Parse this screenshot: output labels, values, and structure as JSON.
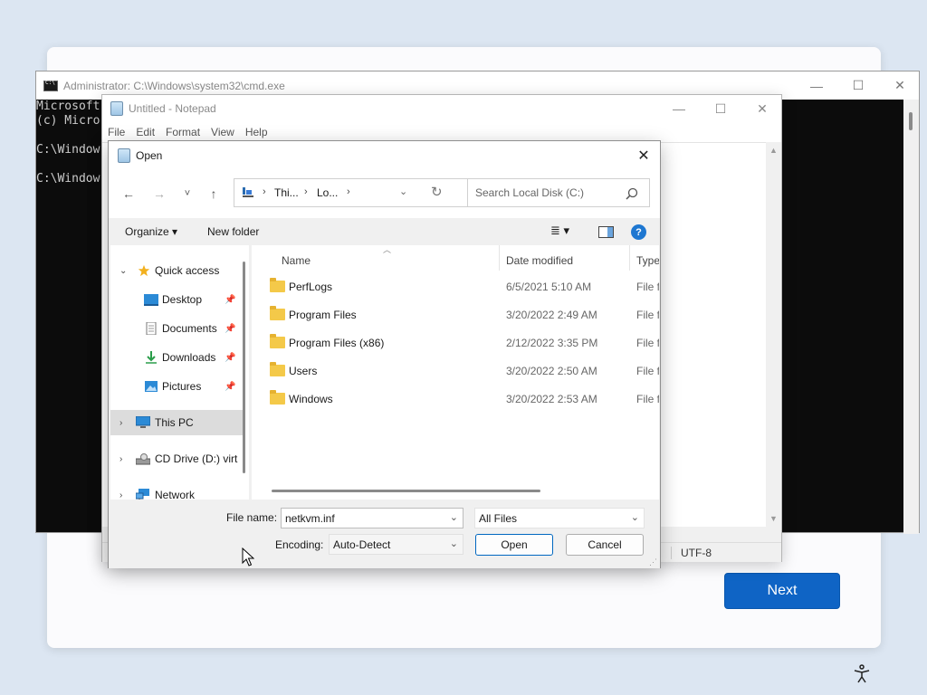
{
  "setup": {
    "next_label": "Next"
  },
  "cmd": {
    "title": "Administrator: C:\\Windows\\system32\\cmd.exe",
    "lines": [
      "Microsoft",
      "(c) Micro",
      "",
      "C:\\Window",
      "",
      "C:\\Window"
    ],
    "minimize": "—",
    "maximize": "☐",
    "close": "✕"
  },
  "notepad": {
    "title": "Untitled - Notepad",
    "menu": [
      "File",
      "Edit",
      "Format",
      "View",
      "Help"
    ],
    "minimize": "—",
    "maximize": "☐",
    "close": "✕",
    "encoding": "UTF-8"
  },
  "dialog": {
    "title": "Open",
    "close": "✕",
    "nav": {
      "back": "←",
      "forward": "→",
      "recent": "˅",
      "up": "↑"
    },
    "breadcrumb": [
      "Thi...",
      "Lo..."
    ],
    "search_placeholder": "Search Local Disk (C:)",
    "toolbar": {
      "organize": "Organize ▾",
      "new_folder": "New folder",
      "view": "≣ ▾",
      "help": "?"
    },
    "tree": [
      {
        "label": "Quick access",
        "icon": "star-icon",
        "color": "#f2b01e"
      },
      {
        "label": "Desktop",
        "icon": "desktop-icon",
        "color": "#2b8ad6"
      },
      {
        "label": "Documents",
        "icon": "documents-icon",
        "color": "#888888"
      },
      {
        "label": "Downloads",
        "icon": "download-icon",
        "color": "#2a9d4a"
      },
      {
        "label": "Pictures",
        "icon": "pictures-icon",
        "color": "#2b8ad6"
      },
      {
        "label": "This PC",
        "icon": "computer-icon",
        "color": "#2b8ad6"
      },
      {
        "label": "CD Drive (D:) virt",
        "icon": "cd-drive-icon",
        "color": "#777777"
      },
      {
        "label": "Network",
        "icon": "network-icon",
        "color": "#2b8ad6"
      }
    ],
    "columns": [
      "Name",
      "Date modified",
      "Type"
    ],
    "files": [
      {
        "name": "PerfLogs",
        "date": "6/5/2021 5:10 AM",
        "type": "File fo"
      },
      {
        "name": "Program Files",
        "date": "3/20/2022 2:49 AM",
        "type": "File fo"
      },
      {
        "name": "Program Files (x86)",
        "date": "2/12/2022 3:35 PM",
        "type": "File fo"
      },
      {
        "name": "Users",
        "date": "3/20/2022 2:50 AM",
        "type": "File fo"
      },
      {
        "name": "Windows",
        "date": "3/20/2022 2:53 AM",
        "type": "File fo"
      }
    ],
    "file_name_label": "File name:",
    "file_name_value": "netkvm.inf",
    "file_type_value": "All Files",
    "encoding_label": "Encoding:",
    "encoding_value": "Auto-Detect",
    "open_label": "Open",
    "cancel_label": "Cancel"
  }
}
